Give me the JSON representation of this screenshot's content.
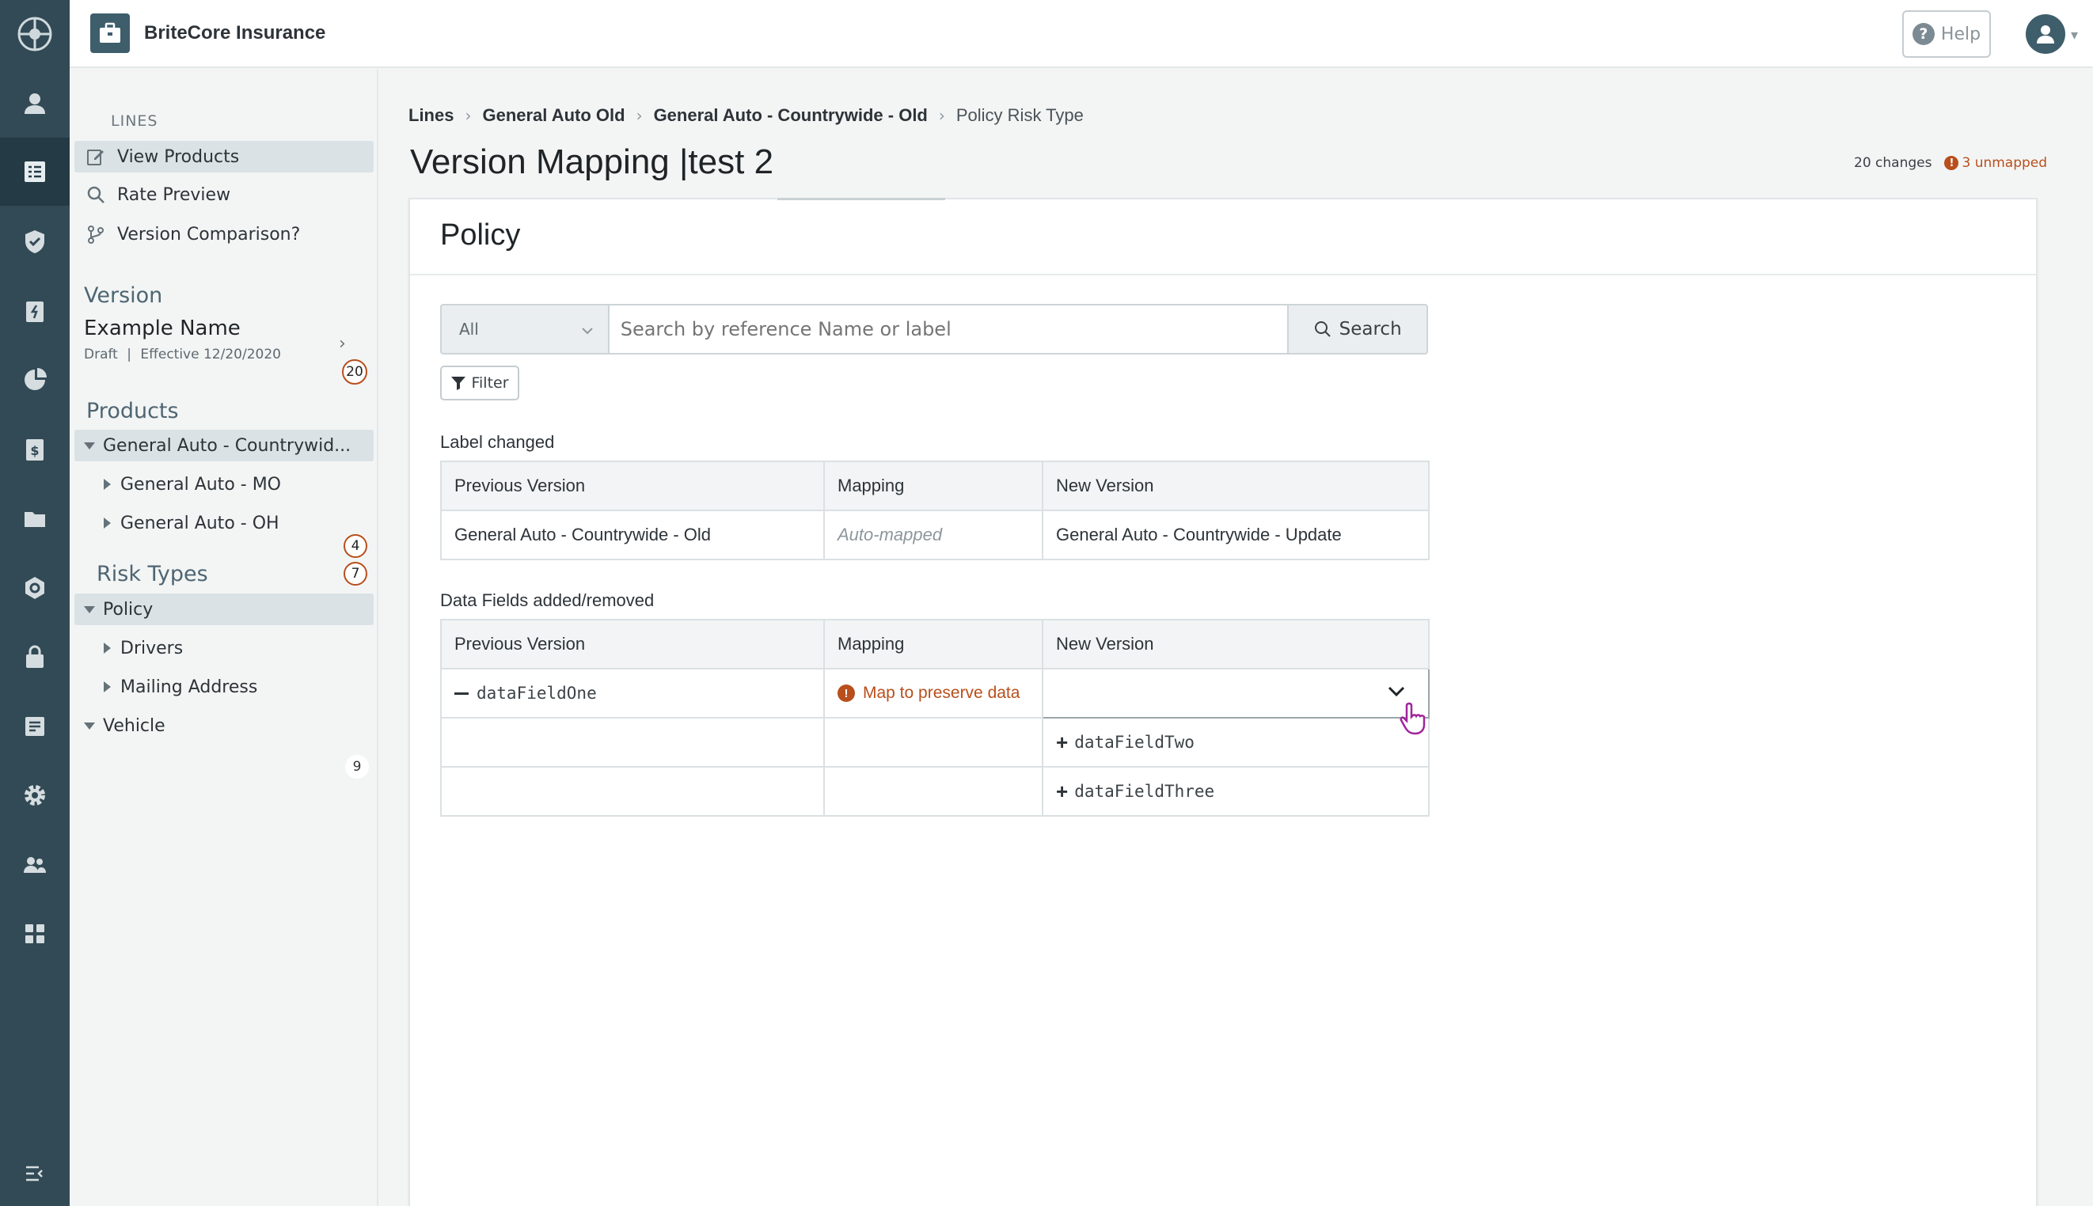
{
  "app": {
    "name": "BriteCore Insurance"
  },
  "topbar": {
    "help_label": "Help"
  },
  "rail": {
    "icons": [
      "britecore-logo-icon",
      "contacts-icon",
      "lines-icon",
      "policies-icon",
      "claims-icon",
      "reports-icon",
      "billing-icon",
      "documents-icon",
      "integrations-icon",
      "security-icon",
      "forms-icon",
      "settings-icon",
      "users-icon",
      "apps-icon",
      "collapse-icon"
    ],
    "active": "lines-icon"
  },
  "sidebar": {
    "lines_label": "LINES",
    "nav": [
      {
        "label": "View Products",
        "icon": "edit-icon",
        "selected": true
      },
      {
        "label": "Rate Preview",
        "icon": "search-icon",
        "selected": false
      },
      {
        "label": "Version Comparison?",
        "icon": "branch-icon",
        "selected": false
      }
    ],
    "version": {
      "heading": "Version",
      "name": "Example Name",
      "status": "Draft",
      "effective": "Effective 12/20/2020",
      "count": "20"
    },
    "products": {
      "heading": "Products",
      "parent": "General Auto - Countrywid...",
      "children": [
        "General Auto - MO",
        "General Auto - OH"
      ],
      "count": "4"
    },
    "risk_types": {
      "heading": "Risk Types",
      "count": "7",
      "parent": "Policy",
      "children": [
        "Drivers",
        "Mailing Address"
      ],
      "vehicle": "Vehicle",
      "vehicle_count": "9"
    }
  },
  "breadcrumb": [
    "Lines",
    "General Auto Old",
    "General Auto - Countrywide - Old",
    "Policy Risk Type"
  ],
  "page": {
    "title": "Version Mapping |test 2",
    "changes": "20 changes",
    "unmapped": "3 unmapped"
  },
  "card": {
    "title": "Policy",
    "select_value": "All",
    "search_placeholder": "Search by reference Name or label",
    "search_button": "Search",
    "filter_button": "Filter"
  },
  "label_changed": {
    "heading": "Label changed",
    "columns": [
      "Previous Version",
      "Mapping",
      "New Version"
    ],
    "row": {
      "previous": "General Auto - Countrywide - Old",
      "mapping": "Auto-mapped",
      "new": "General Auto - Countrywide - Update"
    }
  },
  "data_fields": {
    "heading": "Data Fields added/removed",
    "columns": [
      "Previous Version",
      "Mapping",
      "New Version"
    ],
    "removed": "dataFieldOne",
    "mapping_warning": "Map to preserve data",
    "added": [
      "dataFieldTwo",
      "dataFieldThree"
    ]
  },
  "colors": {
    "rail": "#324a55",
    "warning": "#b84f1c",
    "brand": "#3e5e6b"
  }
}
